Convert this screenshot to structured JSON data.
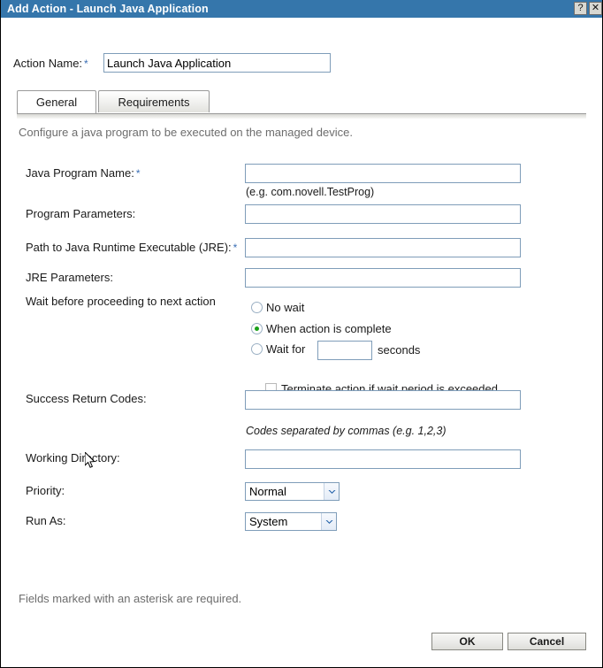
{
  "window": {
    "title": "Add Action - Launch Java Application",
    "help_button": "?",
    "close_button": "✕",
    "help_icon_name": "help-icon",
    "close_icon_name": "close-icon",
    "accent_color": "#3576ab"
  },
  "action_name": {
    "label": "Action Name:",
    "required_marker": "*",
    "value": "Launch Java Application",
    "placeholder": ""
  },
  "tabs": [
    {
      "label": "General",
      "active": true
    },
    {
      "label": "Requirements",
      "active": false
    }
  ],
  "description": "Configure a java program to be executed on the managed device.",
  "fields": {
    "java_program_name": {
      "label": "Java Program Name:",
      "required_marker": "*",
      "value": "",
      "hint": "(e.g. com.novell.TestProg)"
    },
    "program_parameters": {
      "label": "Program Parameters:",
      "value": ""
    },
    "jre_path": {
      "label": "Path to Java Runtime Executable (JRE):",
      "required_marker": "*",
      "value": ""
    },
    "jre_parameters": {
      "label": "JRE Parameters:",
      "value": ""
    },
    "wait": {
      "label": "Wait before proceeding to next action",
      "options": [
        {
          "label": "No wait",
          "selected": false
        },
        {
          "label": "When action is complete",
          "selected": true
        },
        {
          "label": "Wait for",
          "selected": false
        }
      ],
      "seconds_value": "",
      "seconds_suffix": "seconds",
      "terminate_checkbox": {
        "label": "Terminate action if wait period is exceeded",
        "checked": false
      }
    },
    "success_return_codes": {
      "label": "Success Return Codes:",
      "value": "",
      "hint": "Codes separated by commas (e.g. 1,2,3)"
    },
    "working_directory": {
      "label": "Working Directory:",
      "value": ""
    },
    "priority": {
      "label": "Priority:",
      "value": "Normal"
    },
    "run_as": {
      "label": "Run As:",
      "value": "System"
    }
  },
  "footer": {
    "note": "Fields marked with an asterisk are required.",
    "ok_label": "OK",
    "cancel_label": "Cancel"
  }
}
